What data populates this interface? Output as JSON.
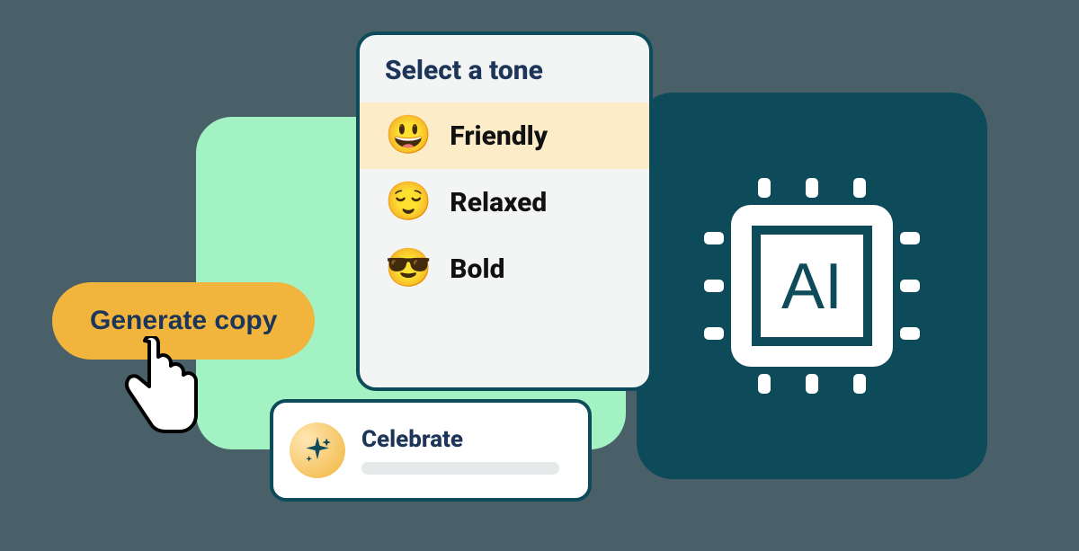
{
  "generate_button": {
    "label": "Generate copy"
  },
  "tone_panel": {
    "title": "Select a tone",
    "options": [
      {
        "emoji": "😃",
        "label": "Friendly",
        "selected": true
      },
      {
        "emoji": "😌",
        "label": "Relaxed",
        "selected": false
      },
      {
        "emoji": "😎",
        "label": "Bold",
        "selected": false
      }
    ]
  },
  "celebrate_card": {
    "label": "Celebrate",
    "icon": "sparkles-icon"
  },
  "ai_card": {
    "label": "AI",
    "icon": "ai-chip-icon"
  }
}
